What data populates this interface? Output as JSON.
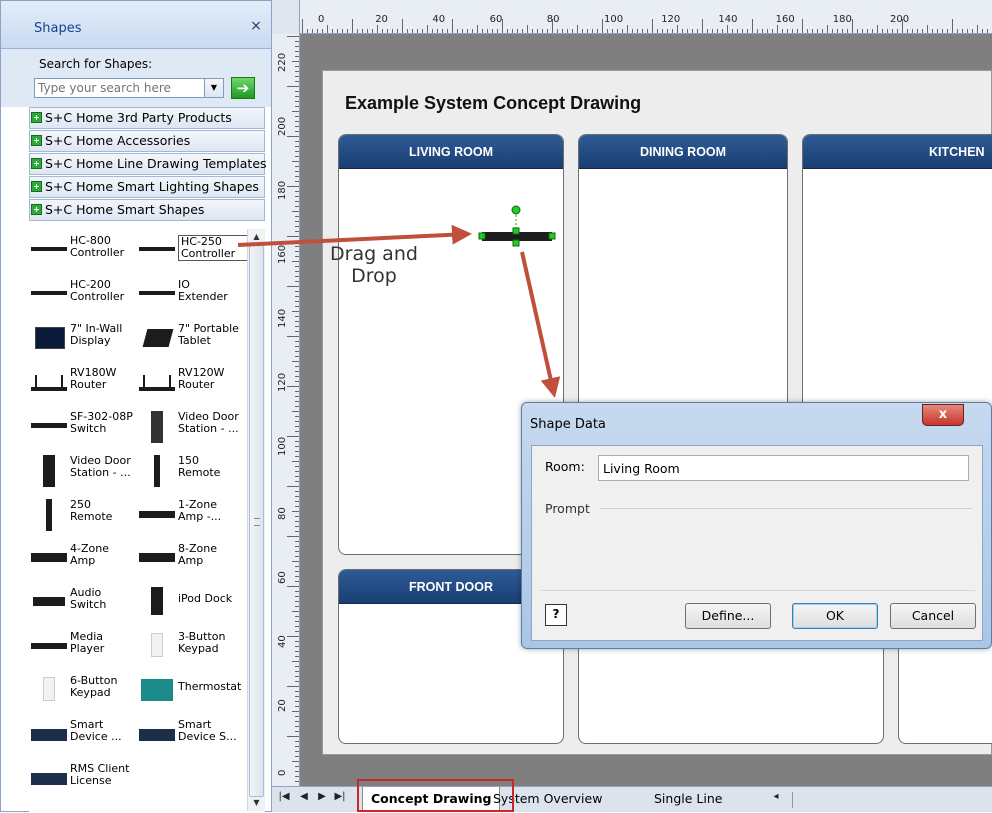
{
  "shapes_pane": {
    "title": "Shapes",
    "close_glyph": "×",
    "search_label": "Search for Shapes:",
    "search_placeholder": "Type your search here",
    "stencils": [
      "S+C Home 3rd Party Products",
      "S+C Home Accessories",
      "S+C Home Line Drawing Templates",
      "S+C Home Smart Lighting Shapes",
      "S+C Home Smart Shapes"
    ],
    "shapes": [
      [
        "HC-800",
        "Controller"
      ],
      [
        "HC-250",
        "Controller"
      ],
      [
        "HC-200",
        "Controller"
      ],
      [
        "IO",
        "Extender"
      ],
      [
        "7\" In-Wall",
        "Display"
      ],
      [
        "7\" Portable",
        "Tablet"
      ],
      [
        "RV180W",
        "Router"
      ],
      [
        "RV120W",
        "Router"
      ],
      [
        "SF-302-08P",
        "Switch"
      ],
      [
        "Video Door",
        "Station - ..."
      ],
      [
        "Video Door",
        "Station - ..."
      ],
      [
        "150",
        "Remote"
      ],
      [
        "250",
        "Remote"
      ],
      [
        "1-Zone",
        "Amp -..."
      ],
      [
        "4-Zone",
        "Amp"
      ],
      [
        "8-Zone",
        "Amp"
      ],
      [
        "Audio",
        "Switch"
      ],
      [
        "iPod Dock",
        ""
      ],
      [
        "Media",
        "Player"
      ],
      [
        "3-Button",
        "Keypad"
      ],
      [
        "6-Button",
        "Keypad"
      ],
      [
        "Thermostat",
        ""
      ],
      [
        "Smart",
        "Device ..."
      ],
      [
        "Smart",
        "Device S..."
      ],
      [
        "RMS Client",
        "License"
      ]
    ]
  },
  "rulers": {
    "top": [
      "0",
      "20",
      "40",
      "60",
      "80",
      "100",
      "120",
      "140",
      "160",
      "180",
      "200"
    ],
    "left": [
      "220",
      "200",
      "180",
      "160",
      "140",
      "120",
      "100",
      "80",
      "60",
      "40",
      "20",
      "0"
    ]
  },
  "drawing": {
    "title": "Example System Concept Drawing",
    "rooms": [
      "LIVING ROOM",
      "DINING ROOM",
      "KITCHEN",
      "FRONT DOOR"
    ],
    "annotation_line1": "Drag and",
    "annotation_line2": "Drop"
  },
  "dialog": {
    "title": "Shape Data",
    "close_glyph": "x",
    "room_label": "Room:",
    "room_value": "Living Room",
    "prompt_label": "Prompt",
    "help_glyph": "?",
    "define_label": "Define...",
    "ok_label": "OK",
    "cancel_label": "Cancel"
  },
  "tabs": {
    "items": [
      "Concept Drawing",
      "System Overview",
      "Single Line"
    ],
    "active": "Concept Drawing"
  },
  "colors": {
    "room_header": "#1f4a82",
    "arrow": "#c0503c",
    "selection_handle": "#22cc22",
    "highlight_box": "#c62828"
  }
}
